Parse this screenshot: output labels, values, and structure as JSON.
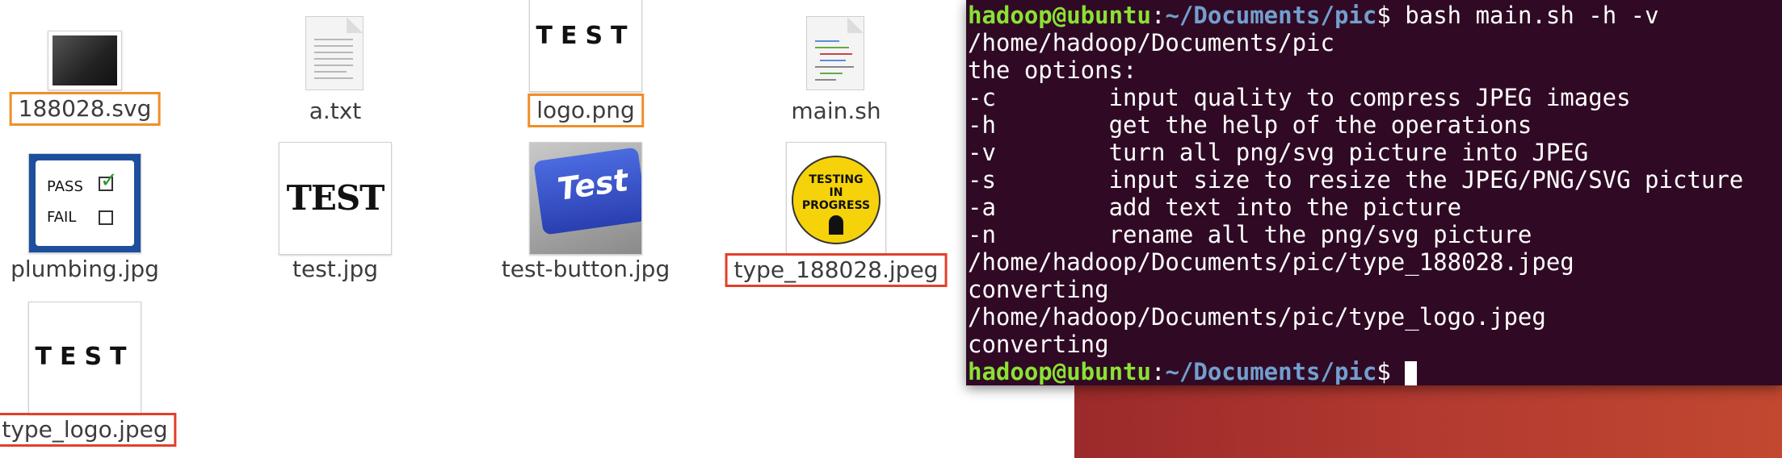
{
  "files": [
    {
      "name": "188028.svg",
      "highlight": "orange"
    },
    {
      "name": "a.txt",
      "highlight": ""
    },
    {
      "name": "logo.png",
      "highlight": "orange"
    },
    {
      "name": "main.sh",
      "highlight": ""
    },
    {
      "name": "plumbing.jpg",
      "highlight": ""
    },
    {
      "name": "test.jpg",
      "highlight": ""
    },
    {
      "name": "test-button.jpg",
      "highlight": ""
    },
    {
      "name": "type_188028.jpeg",
      "highlight": "red"
    },
    {
      "name": "type_logo.jpeg",
      "highlight": "red"
    }
  ],
  "thumb_text": {
    "logo": "TEST",
    "test_jpg": "TEST",
    "test_button": "Test",
    "testing_line1": "TESTING",
    "testing_line2": "IN",
    "testing_line3": "PROGRESS",
    "pass": "PASS",
    "fail": "FAIL",
    "type_logo": "TEST"
  },
  "terminal": {
    "prompt_user": "hadoop@ubuntu",
    "prompt_sep": ":",
    "prompt_path": "~/Documents/pic",
    "prompt_dollar": "$ ",
    "command": "bash main.sh -h -v",
    "output": [
      "/home/hadoop/Documents/pic",
      "the options:",
      "-c        input quality to compress JPEG images",
      "-h        get the help of the operations",
      "-v        turn all png/svg picture into JPEG",
      "-s        input size to resize the JPEG/PNG/SVG picture",
      "-a        add text into the picture",
      "-n        rename all the png/svg picture",
      "/home/hadoop/Documents/pic/type_188028.jpeg",
      "converting",
      "/home/hadoop/Documents/pic/type_logo.jpeg",
      "converting"
    ]
  },
  "colors": {
    "terminal_bg": "#300a24",
    "prompt_user": "#8ae234",
    "prompt_path": "#729fcf",
    "highlight_orange": "#ee8f2a",
    "highlight_red": "#e2402a"
  }
}
